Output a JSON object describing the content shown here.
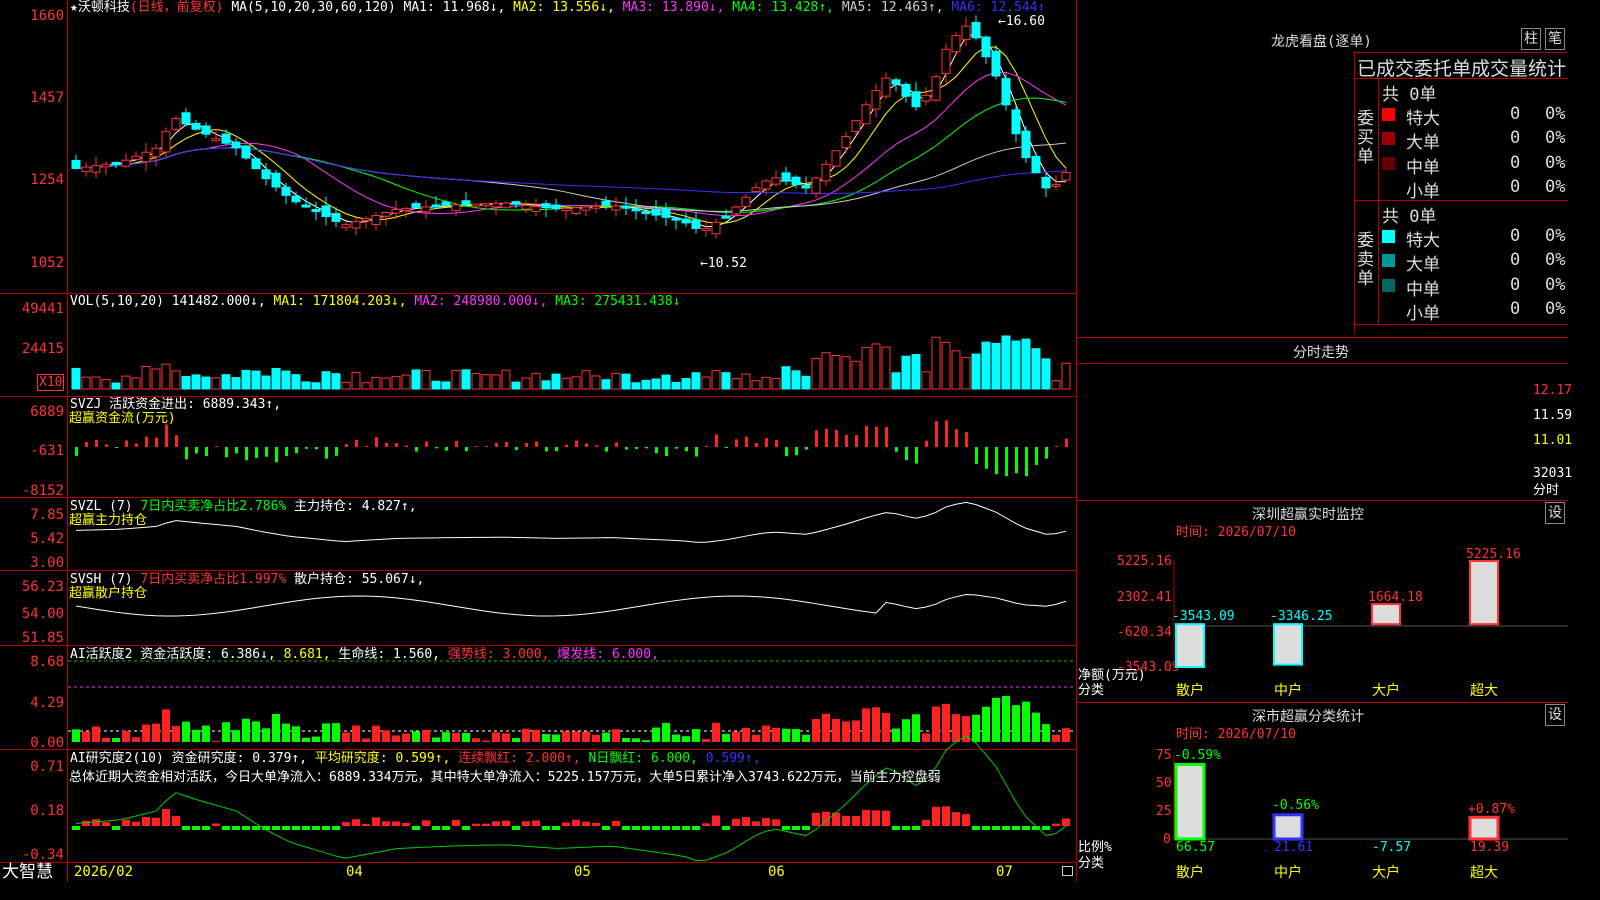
{
  "header": {
    "star": "★",
    "stock_name": "沃顿科技",
    "mode": "(日线，前复权)",
    "ma_label": "MA(5,10,20,30,60,120)",
    "ma": [
      {
        "text": "MA1: 11.968↓,",
        "color": "#ffffff"
      },
      {
        "text": "MA2: 13.556↓,",
        "color": "#ffff00"
      },
      {
        "text": "MA3: 13.890↓,",
        "color": "#ff33ff"
      },
      {
        "text": "MA4: 13.428↑,",
        "color": "#00ff00"
      },
      {
        "text": "MA5: 12.463↑,",
        "color": "#cccccc"
      },
      {
        "text": "MA6: 12.544↑",
        "color": "#3333ff"
      }
    ]
  },
  "price_axis": [
    "1660",
    "1457",
    "1254",
    "1052"
  ],
  "annotations": {
    "high": "←16.60",
    "low": "←10.52"
  },
  "vol": {
    "label": "VOL(5,10,20)",
    "value": "141482.000↓,",
    "ma1": "MA1: 171804.203↓,",
    "ma2": "MA2: 248980.000↓,",
    "ma3": "MA3: 275431.438↓",
    "axis": [
      "49441",
      "24415"
    ],
    "unit": "X10"
  },
  "svzj": {
    "label": "SVZJ",
    "desc": "活跃资金进出: 6889.343↑,",
    "sub": "超赢资金流(万元)",
    "axis": [
      "6889",
      "-631",
      "-8152"
    ]
  },
  "svzl": {
    "label": "SVZL (7)",
    "desc": "7日内买卖净占比2.786%",
    "desc2": "主力持仓: 4.827↑,",
    "sub": "超赢主力持仓",
    "axis": [
      "7.85",
      "5.42",
      "3.00"
    ]
  },
  "svsh": {
    "label": "SVSH (7)",
    "desc": "7日内买卖净占比1.997%",
    "desc2": "散户持仓: 55.067↓,",
    "sub": "超赢散户持仓",
    "axis": [
      "56.23",
      "54.00",
      "51.85"
    ]
  },
  "ai_act": {
    "label": "AI活跃度2",
    "t1": "资金活跃度: 6.386↓,",
    "t2": "8.681,",
    "t3": "生命线: 1.560,",
    "t4": "强势线: 3.000,",
    "t5": "爆发线: 6.000,",
    "axis": [
      "8.68",
      "4.29",
      "0.00"
    ]
  },
  "ai_res": {
    "label": "AI研究度2(10)",
    "t1": "资金研究度: 0.379↑,",
    "t2": "平均研究度: 0.599↑,",
    "t3": "连续飘红: 2.000↑,",
    "t4": "N日飘红: 6.000,",
    "t5": "0.599↑,",
    "summary": "总体近期大资金相对活跃，今日大单净流入：6889.334万元，其中特大单净流入：5225.157万元，大单5日累计净入3743.622万元，当前主力控盘弱",
    "axis": [
      "0.71",
      "0.18",
      "-0.34"
    ]
  },
  "footer": {
    "brand": "大智慧",
    "dates": [
      "2026/02",
      "04",
      "05",
      "06",
      "07"
    ]
  },
  "dragon": {
    "title": "龙虎看盘(逐单)",
    "btn1": "柱",
    "btn2": "笔",
    "stat_title": "已成交委托单成交量统计",
    "buy_label": "委买单",
    "sell_label": "委卖单",
    "buy_total": "共 0单",
    "sell_total": "共 0单",
    "rows": [
      {
        "name": "特大",
        "count": "0",
        "pct": "0%"
      },
      {
        "name": "大单",
        "count": "0",
        "pct": "0%"
      },
      {
        "name": "中单",
        "count": "0",
        "pct": "0%"
      },
      {
        "name": "小单",
        "count": "0",
        "pct": "0%"
      }
    ],
    "buy_colors": [
      "#ff0000",
      "#990000",
      "#660000",
      ""
    ],
    "sell_colors": [
      "#00ffff",
      "#009999",
      "#006666",
      ""
    ]
  },
  "intraday": {
    "title": "分时走势",
    "axis": [
      "12.17",
      "11.59",
      "11.01",
      "32031"
    ],
    "unit": "分时"
  },
  "sz_monitor": {
    "title": "深圳超赢实时监控",
    "btn": "设",
    "date": "时间: 2026/07/10",
    "axis": [
      "5225.16",
      "2302.41",
      "-620.34",
      "-3543.09"
    ],
    "ylabel": "净额(万元)",
    "xlabel": "分类",
    "values": [
      {
        "cat": "散户",
        "v": -3543.09,
        "label": "-3543.09"
      },
      {
        "cat": "中户",
        "v": -3346.25,
        "label": "-3346.25"
      },
      {
        "cat": "大户",
        "v": 1664.18,
        "label": "1664.18"
      },
      {
        "cat": "超大",
        "v": 5225.16,
        "label": "5225.16"
      }
    ],
    "cats": [
      "散户",
      "中户",
      "大户",
      "超大"
    ]
  },
  "sz_class": {
    "title": "深市超赢分类统计",
    "btn": "设",
    "date": "时间: 2026/07/10",
    "axis": [
      "75",
      "50",
      "25",
      "0"
    ],
    "ylabel": "比例%",
    "xlabel": "分类",
    "changes": [
      "-0.59%",
      "-0.56%",
      "",
      "+0.87%"
    ],
    "values": [
      "66.57",
      "21.61",
      "-7.57",
      "19.39"
    ],
    "cats": [
      "散户",
      "中户",
      "大户",
      "超大"
    ]
  }
}
